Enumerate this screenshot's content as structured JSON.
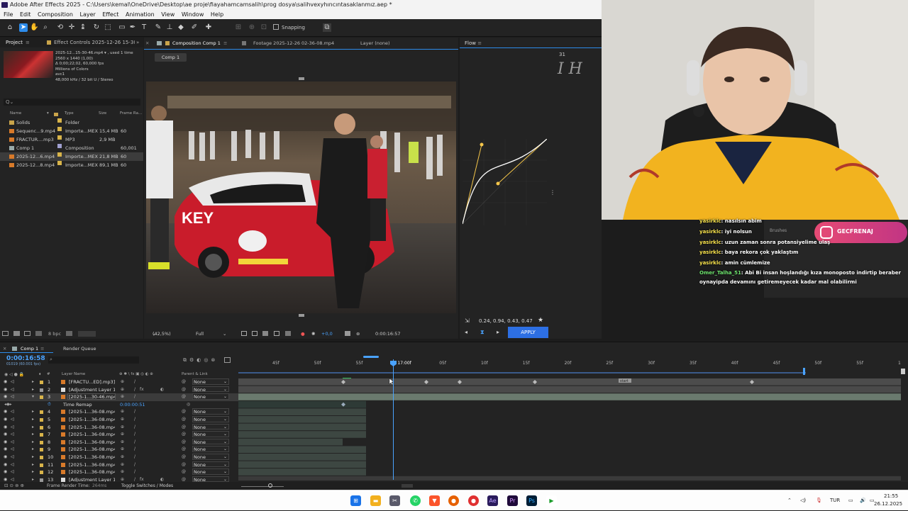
{
  "window": {
    "title": "Adobe After Effects 2025 - C:\\Users\\kemal\\OneDrive\\Desktop\\ae proje\\fiayahamcamsalih\\prog dosya\\salihvexyhıncıntasaklanmız.aep *"
  },
  "menu": [
    "File",
    "Edit",
    "Composition",
    "Layer",
    "Effect",
    "Animation",
    "View",
    "Window",
    "Help"
  ],
  "toolbar": {
    "snapping_label": "Snapping"
  },
  "project_panel": {
    "tab_project": "Project",
    "tab_effect_controls": "Effect Controls 2025-12-26 15-30-46",
    "info": [
      "2025-12...15-30-46.mp4 ▾ , used 1 time",
      "2560 x 1440 (1,00)",
      "Δ 0;00;22;02, 60,000 fps",
      "Millions of Colors",
      "avc1",
      "48,000 kHz / 32 bit U / Stereo"
    ],
    "search_placeholder": "Q⌄",
    "columns": {
      "name": "Name",
      "type": "Type",
      "size": "Size",
      "frame_rate": "Frame Ra..."
    },
    "items": [
      {
        "name": "Solids",
        "type": "Folder",
        "size": "",
        "fps": "",
        "color": "#d8b44a",
        "icon": "folder-icon"
      },
      {
        "name": "Sequenc...9.mp4",
        "type": "Importe...MEX",
        "size": "15,4 MB",
        "fps": "60",
        "color": "#d8b44a",
        "icon": "footage-icon"
      },
      {
        "name": "FRACTUR....mp3",
        "type": "MP3",
        "size": "2,9 MB",
        "fps": "",
        "color": "#d8b44a",
        "icon": "audio-icon"
      },
      {
        "name": "Comp 1",
        "type": "Composition",
        "size": "",
        "fps": "60,001",
        "color": "#a0a0d0",
        "icon": "composition-icon"
      },
      {
        "name": "2025-12...6.mp4",
        "type": "Importe...MEX",
        "size": "21,8 MB",
        "fps": "60",
        "color": "#d8b44a",
        "icon": "footage-icon"
      },
      {
        "name": "2025-12...8.mp4",
        "type": "Importe...MEX",
        "size": "89,1 MB",
        "fps": "60",
        "color": "#d8b44a",
        "icon": "footage-icon"
      }
    ],
    "footer_bpc": "8 bpc"
  },
  "composition_panel": {
    "tab_comp": "Composition Comp 1",
    "tab_footage": "Footage 2025-12-26 02-36-08.mp4",
    "tab_layer": "Layer (none)",
    "comp_button": "Comp 1",
    "zoom": "(42,5%)",
    "resolution": "Full",
    "exposure": "+0,0",
    "current_time": "0:00:16:57"
  },
  "flow_panel": {
    "title": "Flow",
    "preset_number": "31",
    "preset_letters": "I H",
    "values": "0.24, 0.94, 0.43, 0.47",
    "apply_label": "APPLY"
  },
  "timeline": {
    "tab_comp": "Comp 1",
    "tab_render_queue": "Render Queue",
    "timecode": "0:00:16:58",
    "timecode_sub": "01019 (60.001 fps)",
    "header_layer_name": "Layer Name",
    "header_parent": "Parent & Link",
    "ruler_labels": [
      "45f",
      "50f",
      "55f",
      "17:00f",
      "05f",
      "10f",
      "15f",
      "20f",
      "25f",
      "30f",
      "35f",
      "40f",
      "45f",
      "50f",
      "55f",
      "1"
    ],
    "layers": [
      {
        "num": "1",
        "name": "[FRACTU...ED].mp3]",
        "parent": "None",
        "icon": "audio-icon"
      },
      {
        "num": "2",
        "name": "[Adjustment Layer 1]",
        "parent": "None",
        "icon": "adjustment-icon"
      },
      {
        "num": "3",
        "name": "[2025-1...30-46.mp4]",
        "parent": "None",
        "icon": "footage-icon",
        "selected": true
      },
      {
        "num": "4",
        "name": "[2025-1...36-08.mp4]",
        "parent": "None",
        "icon": "footage-icon"
      },
      {
        "num": "5",
        "name": "[2025-1...36-08.mp4]",
        "parent": "None",
        "icon": "footage-icon"
      },
      {
        "num": "6",
        "name": "[2025-1...36-08.mp4]",
        "parent": "None",
        "icon": "footage-icon"
      },
      {
        "num": "7",
        "name": "[2025-1...36-08.mp4]",
        "parent": "None",
        "icon": "footage-icon"
      },
      {
        "num": "8",
        "name": "[2025-1...36-08.mp4]",
        "parent": "None",
        "icon": "footage-icon"
      },
      {
        "num": "9",
        "name": "[2025-1...36-08.mp4]",
        "parent": "None",
        "icon": "footage-icon"
      },
      {
        "num": "10",
        "name": "[2025-1...36-08.mp4]",
        "parent": "None",
        "icon": "footage-icon"
      },
      {
        "num": "11",
        "name": "[2025-1...36-08.mp4]",
        "parent": "None",
        "icon": "footage-icon"
      },
      {
        "num": "12",
        "name": "[2025-1...36-08.mp4]",
        "parent": "None",
        "icon": "footage-icon"
      },
      {
        "num": "13",
        "name": "[Adjustment Layer 1]",
        "parent": "None",
        "icon": "adjustment-icon"
      }
    ],
    "time_remap_label": "Time Remap",
    "time_remap_value": "0:00:00:51",
    "footer_render_time": "Frame Render Time:",
    "footer_render_ms": "264ms",
    "footer_toggle": "Toggle Switches / Modes",
    "marker_label": "start"
  },
  "chat": {
    "side_label": "Brushes",
    "instagram_handle": "GECFRENAJ",
    "messages": [
      {
        "user": "yasirklc",
        "text": ": nasılsın abim"
      },
      {
        "user": "yasirklc",
        "text": ": iyi nolsun"
      },
      {
        "user": "yasirklc",
        "text": ": uzun zaman sonra potansiyelime ulaş"
      },
      {
        "user": "yasirklc",
        "text": ": baya rekora çok yaklaştım"
      },
      {
        "user": "yasirklc",
        "text": ": amin cümlemize"
      },
      {
        "user": "Omer_Talha_51",
        "text": ": Abi Bi insan hoşlandığı kıza monoposto indirtip beraber"
      },
      {
        "user": "",
        "text": "oynayipda devamını getiremeyecek kadar mal olabilirmi"
      }
    ]
  },
  "taskbar": {
    "language": "TUR",
    "time": "21:55",
    "date": "26.12.2025"
  },
  "colors": {
    "accent_blue": "#2d8ceb",
    "timecode_blue": "#4aa3ff",
    "apply_blue": "#2d6fe3",
    "footage_label": "#d8b44a"
  }
}
